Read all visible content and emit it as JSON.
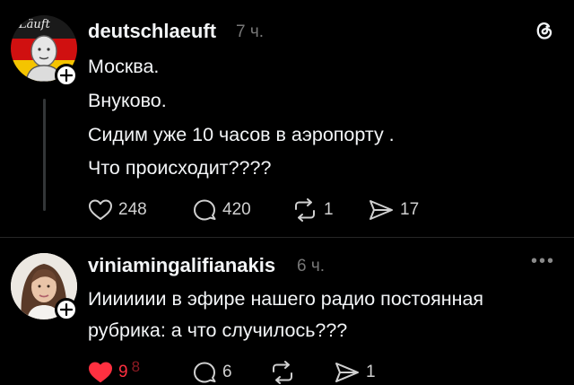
{
  "post1": {
    "avatar_caption": "Läuft",
    "username": "deutschlaeuft",
    "time": "7 ч.",
    "lines": [
      "Москва.",
      "Внуково.",
      "Сидим уже 10 часов в аэропорту .",
      "Что происходит????"
    ],
    "likes": "248",
    "replies": "420",
    "reposts": "1",
    "shares": "17"
  },
  "post2": {
    "username": "viniamingalifianakis",
    "time": "6 ч.",
    "lines": [
      "Иииииии в эфире нашего радио постоянная",
      "рубрика: а что случилось???"
    ],
    "likes": "9",
    "likes_next": "8",
    "replies": "6",
    "shares": "1",
    "liked": true
  },
  "colors": {
    "background": "#000000",
    "text": "#f3f5f7",
    "muted": "#777777",
    "like_active": "#ff3040"
  },
  "icons": [
    "threads-logo-icon",
    "heart-icon",
    "comment-icon",
    "repost-icon",
    "share-icon",
    "plus-icon",
    "more-icon"
  ]
}
